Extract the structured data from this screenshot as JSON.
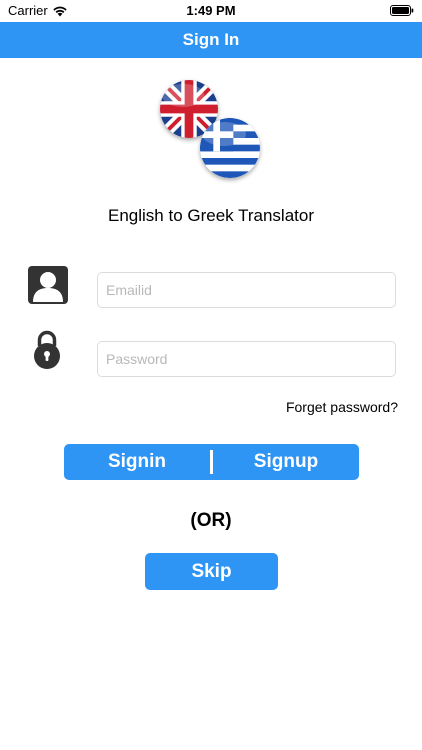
{
  "status_bar": {
    "carrier": "Carrier",
    "time": "1:49 PM",
    "icons": [
      "wifi-icon",
      "battery-icon"
    ]
  },
  "nav": {
    "title": "Sign In"
  },
  "header": {
    "flags": [
      "uk-flag-icon",
      "greece-flag-icon"
    ],
    "app_title": "English to Greek Translator"
  },
  "form": {
    "email": {
      "placeholder": "Emailid",
      "value": "",
      "icon": "user-icon"
    },
    "password": {
      "placeholder": "Password",
      "value": "",
      "icon": "lock-icon"
    },
    "forget_password": "Forget password?"
  },
  "auth": {
    "signin_label": "Signin",
    "signup_label": "Signup",
    "or_label": "(OR)",
    "skip_label": "Skip"
  },
  "colors": {
    "accent": "#2e95f5",
    "icon_dark": "#333333",
    "field_border": "#dcdcdc",
    "placeholder": "#b8b8b8"
  }
}
